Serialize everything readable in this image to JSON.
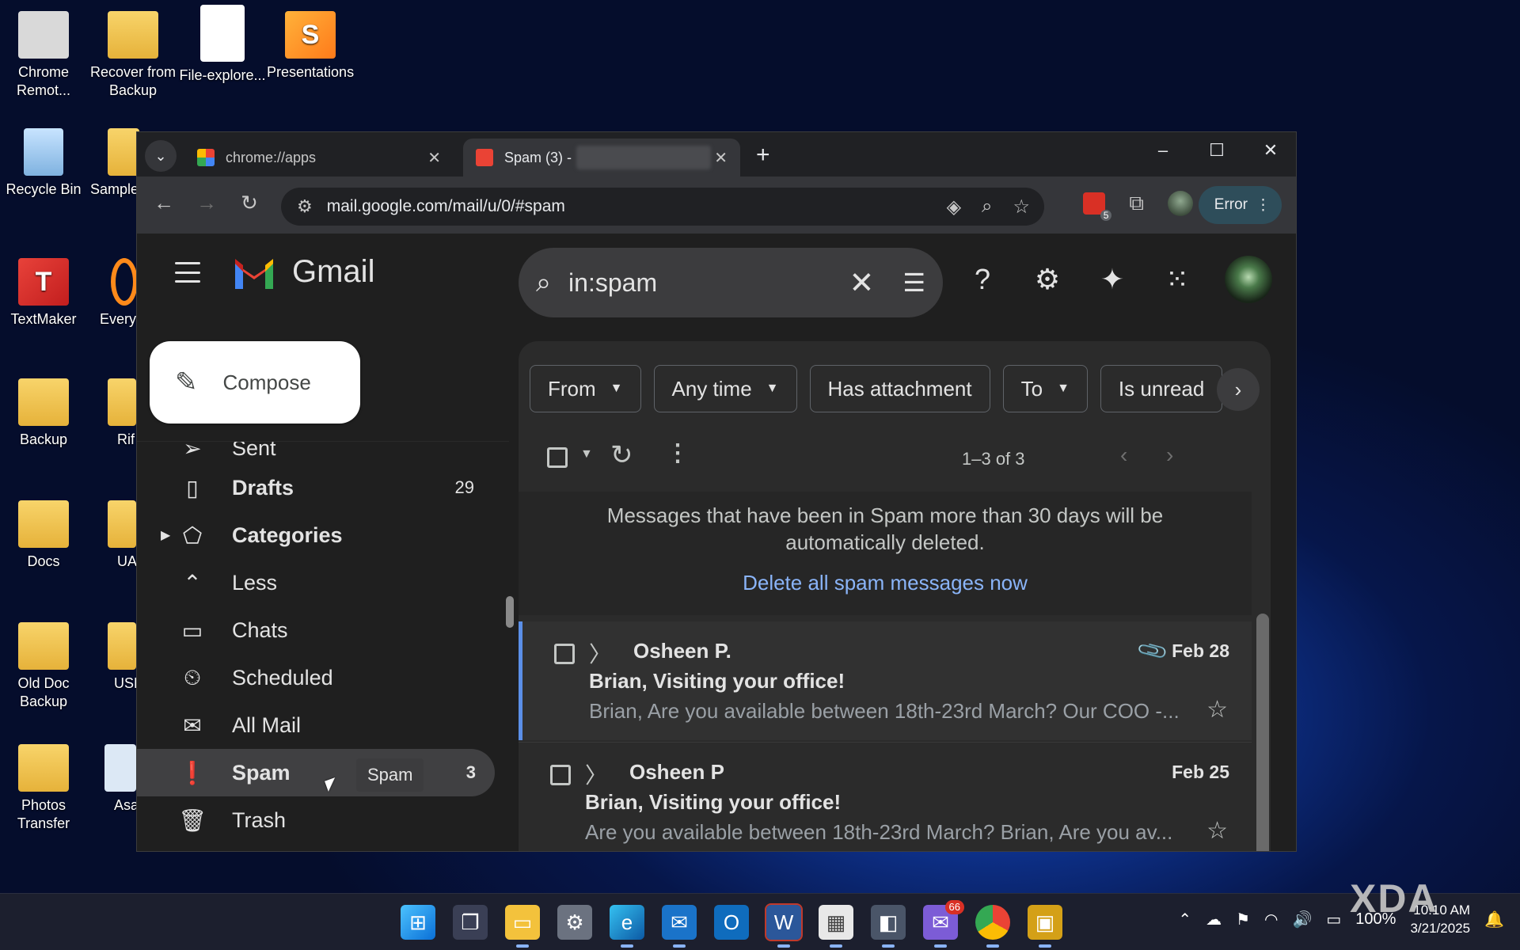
{
  "desktop": {
    "icons": [
      {
        "label": "Chrome Remot...",
        "icon": "chrome-remote-icon"
      },
      {
        "label": "Recover from Backup",
        "icon": "folder-icon"
      },
      {
        "label": "File-explore...",
        "icon": "file-icon"
      },
      {
        "label": "Presentations",
        "icon": "presentations-app-icon"
      },
      {
        "label": "Recycle Bin",
        "icon": "recycle-bin-icon"
      },
      {
        "label": "Sample",
        "icon": "folder-icon"
      },
      {
        "label": "TextMaker",
        "icon": "textmaker-app-icon"
      },
      {
        "label": "Everyt",
        "icon": "search-app-icon"
      },
      {
        "label": "Backup",
        "icon": "folder-icon"
      },
      {
        "label": "Rif",
        "icon": "folder-icon"
      },
      {
        "label": "Docs",
        "icon": "folder-icon"
      },
      {
        "label": "UA",
        "icon": "folder-icon"
      },
      {
        "label": "Old Doc Backup",
        "icon": "folder-icon"
      },
      {
        "label": "USB_D",
        "icon": "folder-icon"
      },
      {
        "label": "Photos Transfer",
        "icon": "folder-icon"
      },
      {
        "label": "Asa",
        "icon": "app-icon"
      }
    ]
  },
  "browser": {
    "tabs": [
      {
        "title": "chrome://apps",
        "close": "✕"
      },
      {
        "title": "Spam (3) -",
        "close": "✕"
      }
    ],
    "new_tab": "+",
    "window_controls": {
      "minimize": "–",
      "maximize": "☐",
      "close": "✕"
    },
    "address": "mail.google.com/mail/u/0/#spam",
    "profile_status": "Error",
    "extension_badge": "5"
  },
  "gmail": {
    "brand": "Gmail",
    "search_query": "in:spam",
    "compose_label": "Compose",
    "nav": {
      "sent": "Sent",
      "drafts": {
        "label": "Drafts",
        "count": "29"
      },
      "categories": "Categories",
      "less": "Less",
      "chats": "Chats",
      "scheduled": "Scheduled",
      "all_mail": "All Mail",
      "spam": {
        "label": "Spam",
        "count": "3"
      },
      "trash": "Trash"
    },
    "tooltip": "Spam",
    "filters": [
      "From",
      "Any time",
      "Has attachment",
      "To",
      "Is unread"
    ],
    "page_count": "1–3 of 3",
    "notice": {
      "message": "Messages that have been in Spam more than 30 days will be automatically deleted.",
      "action": "Delete all spam messages now"
    },
    "messages": [
      {
        "from": "Osheen P.",
        "date": "Feb 28",
        "subject": "Brian, Visiting your office!",
        "snippet": "Brian, Are you available between 18th-23rd March? Our COO -...",
        "has_attachment": true
      },
      {
        "from": "Osheen P",
        "date": "Feb 25",
        "subject": "Brian, Visiting your office!",
        "snippet": "Are you available between 18th-23rd March? Brian, Are you av...",
        "has_attachment": false
      }
    ]
  },
  "taskbar": {
    "mail_badge": "66",
    "battery": "100%",
    "time": "10:10 AM",
    "date": "3/21/2025"
  },
  "watermark": "XDA"
}
